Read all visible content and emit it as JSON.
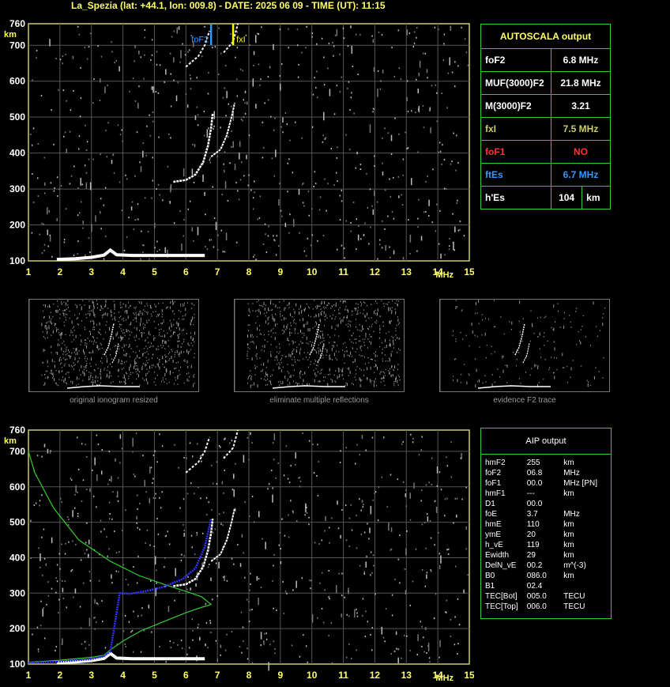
{
  "header": "La_Spezia (lat: +44.1, lon: 009.8) - DATE: 2025 06 09 - TIME (UT): 11:15",
  "chart_data": [
    {
      "type": "scatter",
      "xlabel": "MHz",
      "ylabel": "km",
      "xlim": [
        1,
        15
      ],
      "ylim": [
        100,
        760
      ],
      "x_ticks": [
        "1",
        "2",
        "3",
        "4",
        "5",
        "6",
        "7",
        "8",
        "9",
        "10",
        "11",
        "12",
        "13",
        "14",
        "15"
      ],
      "y_ticks": [
        "100",
        "200",
        "300",
        "400",
        "500",
        "600",
        "700",
        "760"
      ],
      "grid": true,
      "markers": [
        {
          "label": "foF2",
          "x": 6.8,
          "color": "#3399ff"
        },
        {
          "label": "fxI",
          "x": 7.5,
          "color": "#ffff00"
        }
      ]
    },
    {
      "type": "line",
      "xlabel": "MHz",
      "ylabel": "km",
      "xlim": [
        1,
        15
      ],
      "ylim": [
        100,
        760
      ],
      "x_ticks": [
        "1",
        "2",
        "3",
        "4",
        "5",
        "6",
        "7",
        "8",
        "9",
        "10",
        "11",
        "12",
        "13",
        "14",
        "15"
      ],
      "y_ticks": [
        "100",
        "200",
        "300",
        "400",
        "500",
        "600",
        "700",
        "760"
      ],
      "grid": true,
      "series": [
        {
          "color": "#33cc33",
          "x": [
            1.0,
            1.5,
            2.0,
            2.5,
            3.0,
            3.4,
            3.6,
            4.0,
            4.6,
            5.3,
            6.0,
            6.5,
            6.8,
            6.5,
            6.0,
            5.3,
            4.5,
            3.6,
            2.6,
            1.8,
            1.2,
            1.0
          ],
          "y": [
            105,
            108,
            111,
            115,
            119,
            125,
            140,
            165,
            195,
            220,
            245,
            260,
            268,
            290,
            305,
            325,
            350,
            390,
            450,
            540,
            640,
            700
          ]
        },
        {
          "color": "#3333ff",
          "x": [
            1.0,
            2.0,
            3.0,
            3.4,
            3.6,
            3.9,
            4.2,
            4.7,
            5.3,
            5.9,
            6.3,
            6.6,
            6.8
          ],
          "y": [
            104,
            107,
            114,
            122,
            135,
            300,
            298,
            305,
            318,
            340,
            370,
            430,
            510
          ]
        }
      ]
    }
  ],
  "autoscala": {
    "title": "AUTOSCALA output",
    "rows": [
      {
        "label": "foF2",
        "value": "6.8 MHz",
        "label_color": "#ffffff",
        "value_color": "#ffffff"
      },
      {
        "label": "MUF(3000)F2",
        "value": "21.8 MHz",
        "label_color": "#ffffff",
        "value_color": "#ffffff"
      },
      {
        "label": "M(3000)F2",
        "value": "3.21",
        "label_color": "#ffffff",
        "value_color": "#ffffff"
      },
      {
        "label": "fxI",
        "value": "7.5 MHz",
        "label_color": "#cccc66",
        "value_color": "#cccc66"
      },
      {
        "label": "foF1",
        "value": "NO",
        "label_color": "#ff3333",
        "value_color": "#ff3333"
      },
      {
        "label": "ftEs",
        "value": "6.7 MHz",
        "label_color": "#3399ff",
        "value_color": "#3399ff"
      },
      {
        "label": "h'Es",
        "value": "104",
        "unit": "km",
        "label_color": "#ffffff",
        "value_color": "#ffffff"
      }
    ]
  },
  "thumbnails": [
    {
      "caption": "original ionogram resized"
    },
    {
      "caption": "eliminate multiple reflections"
    },
    {
      "caption": "evidence F2 trace"
    }
  ],
  "aip": {
    "title": "AIP output",
    "rows": [
      [
        "hmF2",
        "255",
        "km"
      ],
      [
        "foF2",
        "06.8",
        "MHz"
      ],
      [
        "foF1",
        "00.0",
        "MHz   [PN]"
      ],
      [
        "hmF1",
        "---",
        "km"
      ],
      [
        "D1",
        "00.0",
        ""
      ],
      [
        "foE",
        "3.7",
        "MHz"
      ],
      [
        "hmE",
        "110",
        "km"
      ],
      [
        "ymE",
        "20",
        "km"
      ],
      [
        "h_vE",
        "119",
        "km"
      ],
      [
        "Ewidth",
        "29",
        "km"
      ],
      [
        "DelN_vE",
        "00.2",
        "m^(-3)"
      ],
      [
        "B0",
        "086.0",
        "km"
      ],
      [
        "B1",
        "02.4",
        ""
      ],
      [
        "TEC[Bot]",
        "005.0",
        "TECU"
      ],
      [
        "TEC[Top]",
        "006.0",
        "TECU"
      ]
    ]
  }
}
